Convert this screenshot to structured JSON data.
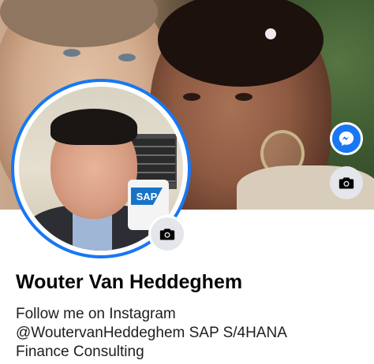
{
  "profile": {
    "name": "Wouter Van Heddeghem",
    "bio_lines": [
      "Follow me on Instagram",
      "@WoutervanHeddeghem SAP S/4HANA",
      "Finance Consulting"
    ],
    "avatar_mug_logo": "SAP"
  },
  "icons": {
    "messenger": "messenger-icon",
    "cover_camera": "camera-icon",
    "avatar_camera": "camera-icon"
  },
  "colors": {
    "accent": "#1877f2",
    "icon_button_bg": "#e4e6eb",
    "text_primary": "#050505"
  }
}
